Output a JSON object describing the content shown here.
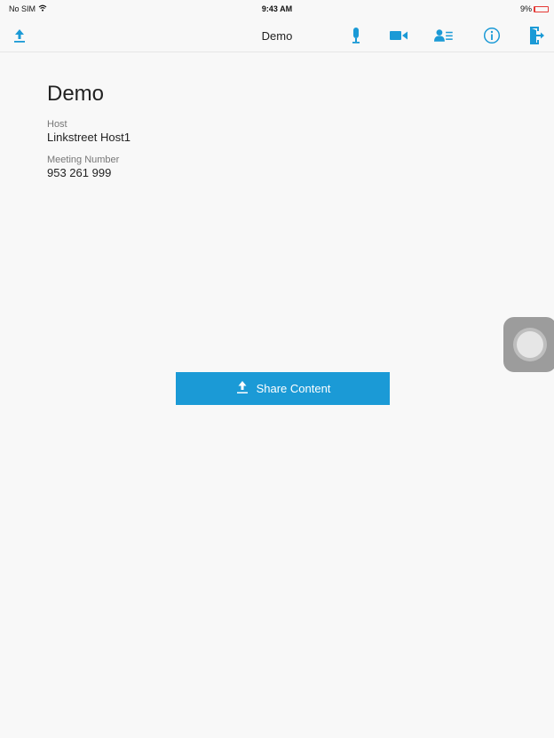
{
  "status_bar": {
    "carrier": "No SIM",
    "time": "9:43 AM",
    "battery_percent_text": "9%",
    "battery_level": 0.09
  },
  "nav": {
    "title": "Demo",
    "icons": [
      "upload-icon",
      "microphone-icon",
      "video-camera-icon",
      "participants-icon",
      "info-icon",
      "exit-icon"
    ]
  },
  "meeting": {
    "title": "Demo",
    "host_label": "Host",
    "host_value": "Linkstreet Host1",
    "number_label": "Meeting Number",
    "number_value": "953 261 999"
  },
  "share_button": {
    "label": "Share Content"
  },
  "colors": {
    "accent": "#1b9ad6",
    "background": "#f8f8f8",
    "battery_low": "#e53935"
  }
}
